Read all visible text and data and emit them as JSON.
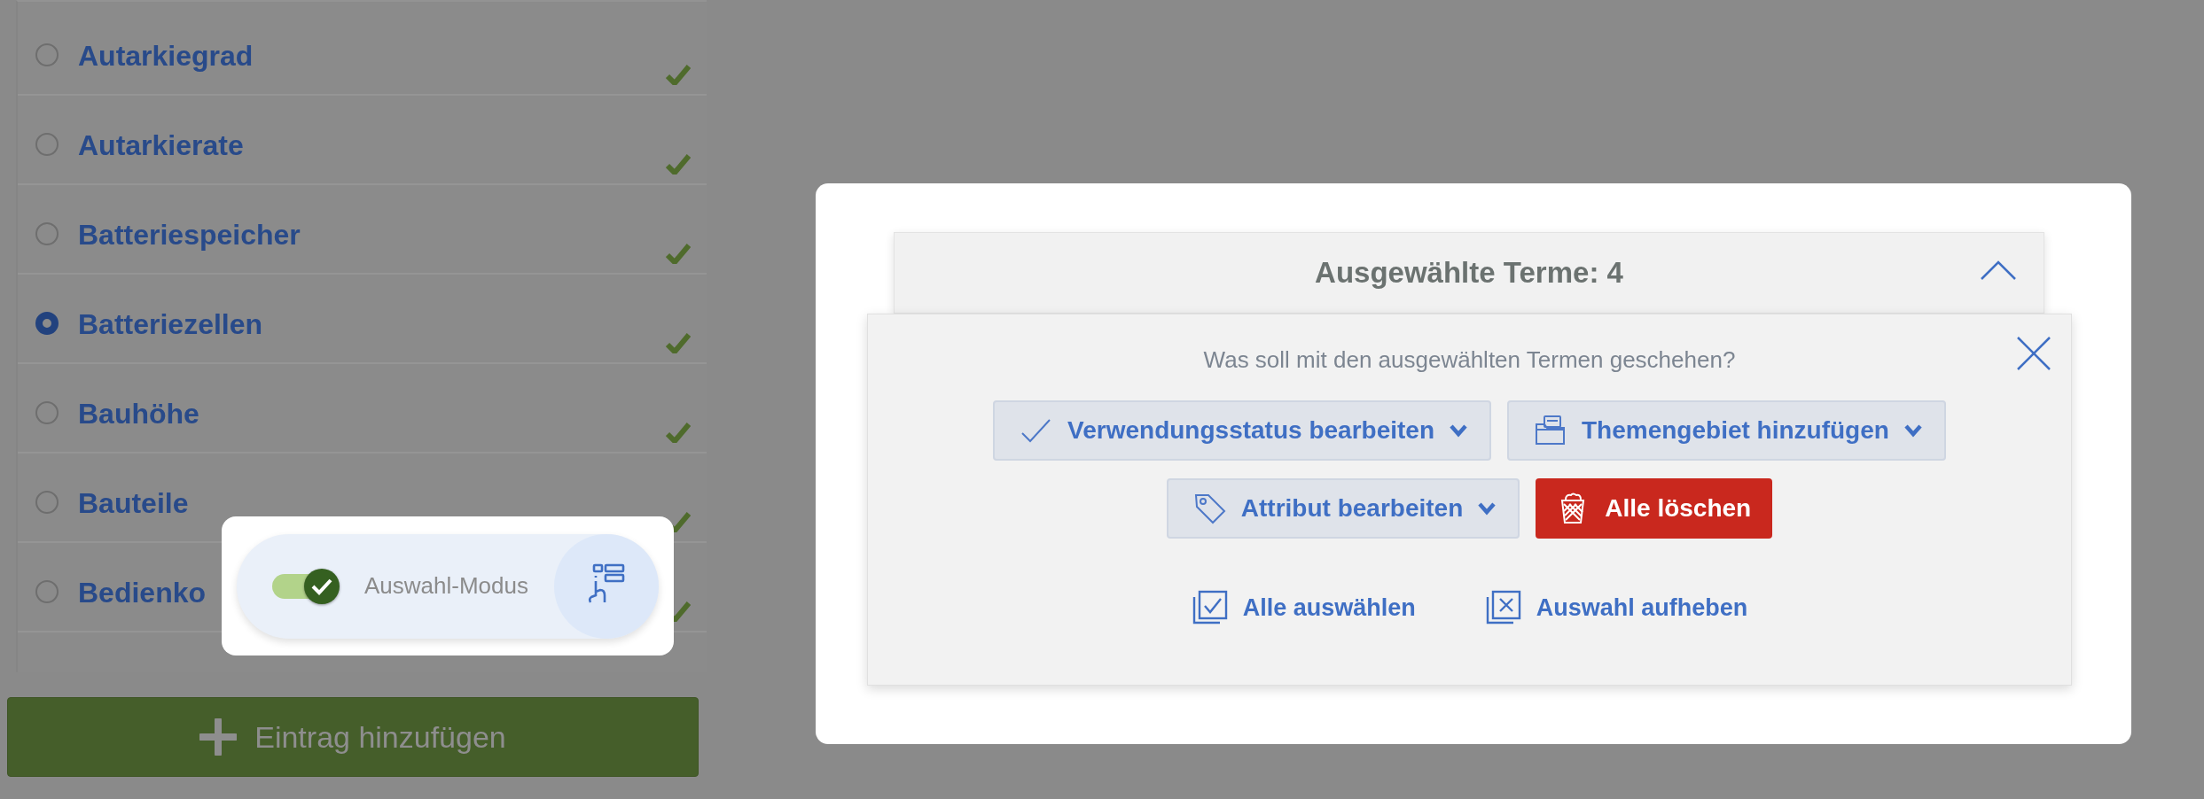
{
  "list": {
    "items": [
      {
        "label": "Autarkiegrad",
        "selected": false,
        "verified": true
      },
      {
        "label": "Autarkierate",
        "selected": false,
        "verified": true
      },
      {
        "label": "Batteriespeicher",
        "selected": false,
        "verified": true
      },
      {
        "label": "Batteriezellen",
        "selected": true,
        "verified": true
      },
      {
        "label": "Bauhöhe",
        "selected": false,
        "verified": true
      },
      {
        "label": "Bauteile",
        "selected": false,
        "verified": true
      },
      {
        "label": "Bedienko",
        "selected": false,
        "verified": true
      }
    ]
  },
  "add_button": {
    "label": "Eintrag hinzufügen"
  },
  "selection_mode": {
    "label": "Auswahl-Modus",
    "on": true
  },
  "dialog": {
    "header": {
      "title": "Ausgewählte Terme: 4",
      "expanded": true
    },
    "question": "Was soll mit den ausgewählten Termen geschehen?",
    "actions": [
      {
        "kind": "dropdown",
        "label": "Verwendungsstatus bearbeiten"
      },
      {
        "kind": "dropdown",
        "label": "Themengebiet hinzufügen"
      },
      {
        "kind": "dropdown",
        "label": "Attribut bearbeiten"
      },
      {
        "kind": "danger",
        "label": "Alle löschen"
      }
    ],
    "links": [
      {
        "label": "Alle auswählen"
      },
      {
        "label": "Auswahl aufheben"
      }
    ]
  }
}
